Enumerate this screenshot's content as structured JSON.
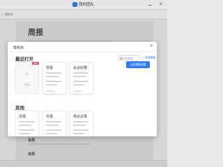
{
  "window": {
    "app_title": "我的团队",
    "toolbar_label": "模板库"
  },
  "document": {
    "title": "周报",
    "headings": [
      "本周",
      "本周"
    ]
  },
  "modal": {
    "title": "模板库",
    "close_label": "✕",
    "recent_section": "最近打开",
    "other_section": "其他",
    "search_placeholder": "搜索模板",
    "new_template_link": "+ 新建模板",
    "create_button": "从此模板创建",
    "blank_card": {
      "label": "新建",
      "badge": "NEW"
    },
    "recent_cards": [
      {
        "title": "周报"
      },
      {
        "title": "会议纪要"
      }
    ],
    "other_cards": [
      {
        "title": "月报"
      },
      {
        "title": "日报"
      },
      {
        "title": "拜访记录"
      }
    ]
  },
  "colors": {
    "accent": "#2f7cf6",
    "badge": "#f04b4b"
  }
}
